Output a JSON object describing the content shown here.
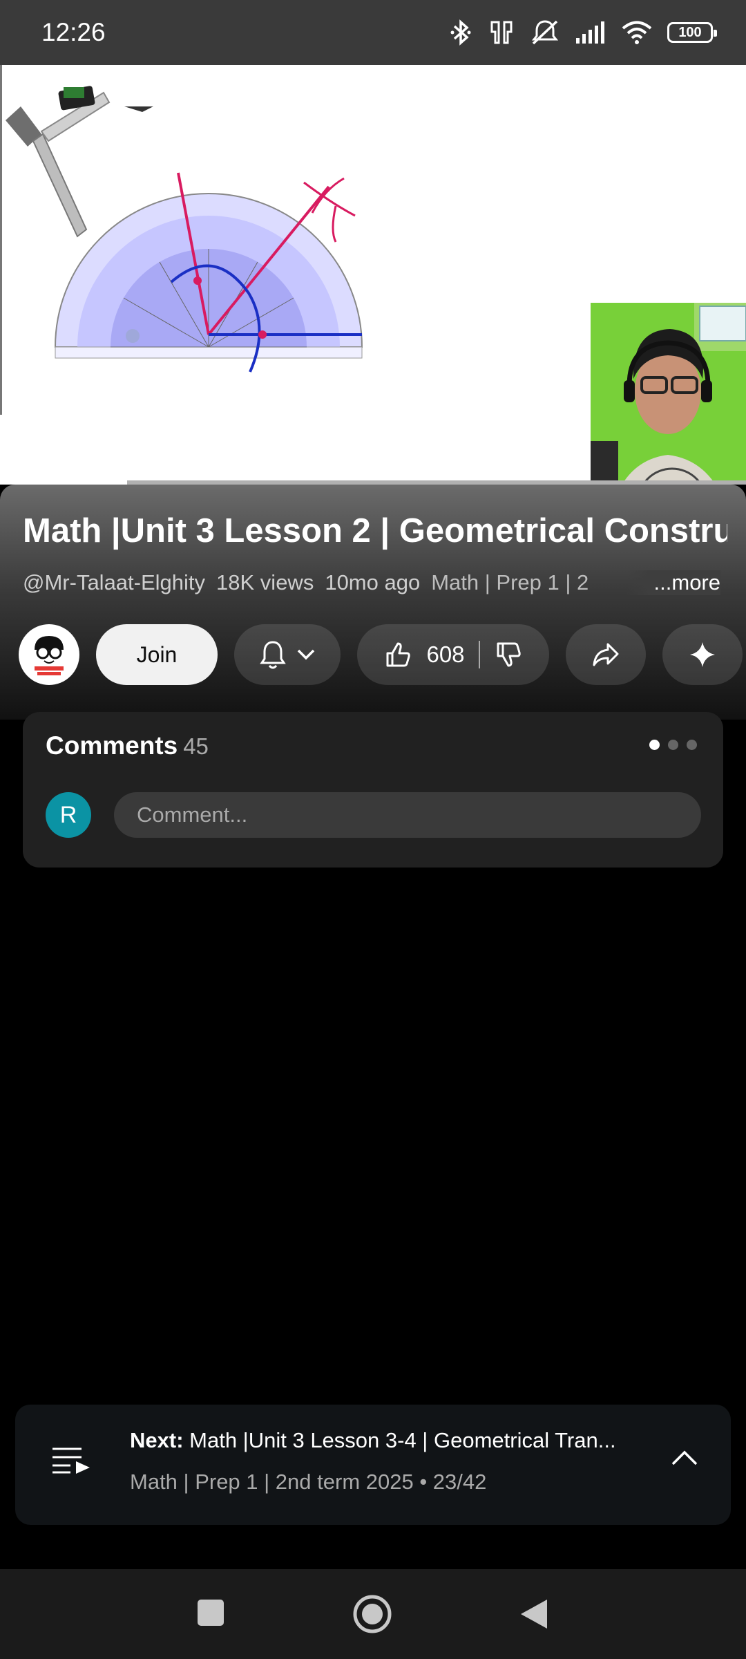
{
  "status_bar": {
    "time": "12:26",
    "battery": "100"
  },
  "video": {
    "progress_fraction": 0.17
  },
  "info": {
    "title": "Math |Unit 3 Lesson 2 | Geometrical Constru..",
    "channel": "@Mr-Talaat-Elghity",
    "views": "18K views",
    "age": "10mo ago",
    "playlist": "Math | Prep 1 | 2",
    "more": "...more"
  },
  "actions": {
    "join_label": "Join",
    "like_count": "608"
  },
  "comments": {
    "title": "Comments",
    "count": "45",
    "avatar_letter": "R",
    "placeholder": "Comment..."
  },
  "next": {
    "prefix": "Next:",
    "title": "Math |Unit 3 Lesson 3-4 | Geometrical Tran...",
    "subtitle": "Math | Prep 1 | 2nd term 2025 • 23/42"
  },
  "colors": {
    "comment_avatar": "#0b93a4",
    "protractor_fill": "#c9c9ff",
    "construction_red": "#d81b60",
    "construction_blue": "#1a2fc4"
  }
}
